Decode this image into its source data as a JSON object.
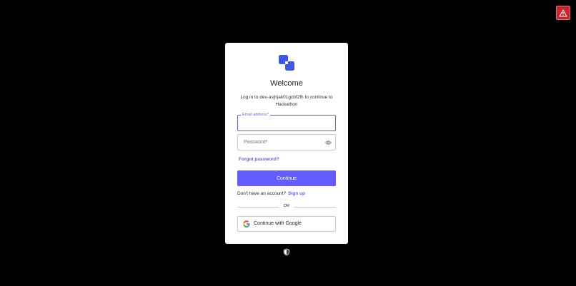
{
  "login": {
    "title": "Welcome",
    "subtitle": "Log in to dev-asjhjak01gcbf2fh to continue to Hackathon",
    "email": {
      "label": "Email address*",
      "value": ""
    },
    "password": {
      "placeholder": "Password*",
      "value": ""
    },
    "forgot_link": "Forgot password?",
    "continue_button": "Continue",
    "signup": {
      "prompt": "Don't have an account?",
      "link": "Sign up"
    },
    "divider": "OR",
    "google_button": "Continue with Google"
  },
  "icons": {
    "logo": "app-logo-icon",
    "eye": "eye-icon",
    "google": "google-icon",
    "alert": "warning-icon",
    "shield": "shield-icon"
  },
  "colors": {
    "background": "#000000",
    "card": "#ffffff",
    "accent": "#635dff",
    "alert": "#c8262a"
  }
}
